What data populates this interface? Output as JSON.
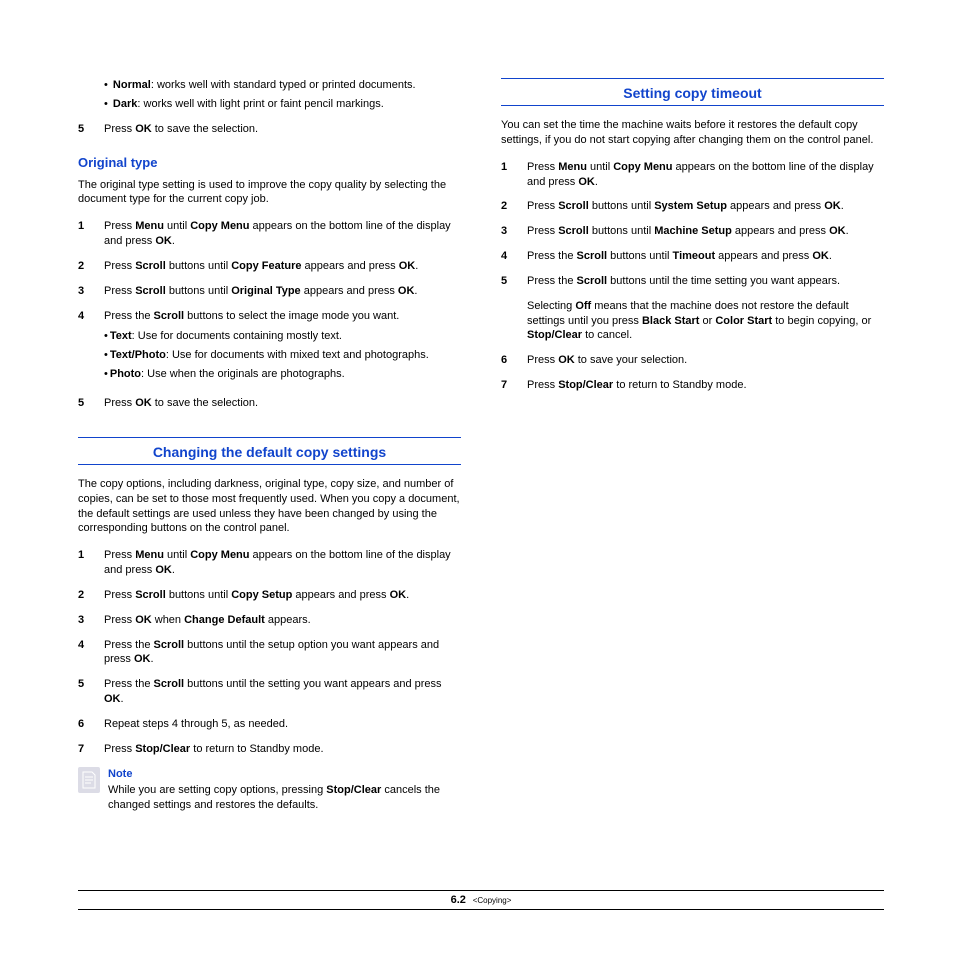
{
  "left": {
    "bullets": [
      {
        "term": "Normal",
        "desc": ": works well with standard typed or printed documents."
      },
      {
        "term": "Dark",
        "desc": ": works well with light print or faint pencil markings."
      }
    ],
    "step5_pre": "Press ",
    "step5_bold": "OK",
    "step5_post": " to save the selection.",
    "original_type_heading": "Original type",
    "original_type_intro": "The original type setting is used to improve the copy quality by selecting the document type for the current copy job.",
    "ot_steps": {
      "s1": {
        "t": "Press ",
        "b1": "Menu",
        "t2": " until ",
        "b2": "Copy Menu",
        "t3": " appears on the bottom line of the display and press ",
        "b3": "OK",
        "t4": "."
      },
      "s2": {
        "t": "Press ",
        "b1": "Scroll",
        "t2": " buttons until ",
        "b2": "Copy Feature",
        "t3": " appears and press ",
        "b3": "OK",
        "t4": "."
      },
      "s3": {
        "t": "Press ",
        "b1": "Scroll",
        "t2": " buttons until ",
        "b2": "Original Type",
        "t3": " appears and press ",
        "b3": "OK",
        "t4": "."
      },
      "s4": {
        "t": "Press the ",
        "b1": "Scroll",
        "t2": " buttons to select the image mode you want."
      },
      "s4_bullets": [
        {
          "term": "Text",
          "desc": ": Use for documents containing mostly text."
        },
        {
          "term": "Text/Photo",
          "desc": ": Use for documents with mixed text and photographs."
        },
        {
          "term": "Photo",
          "desc": ": Use when the originals are photographs."
        }
      ],
      "s5": {
        "t": "Press ",
        "b1": "OK",
        "t2": " to save the selection."
      }
    },
    "changing_heading": "Changing the default copy settings",
    "changing_intro": "The copy options, including darkness, original type, copy size, and number of copies, can be set to those most frequently used. When you copy a document, the default settings are used unless they have been changed by using the corresponding buttons on the control panel.",
    "ch_steps": {
      "s1": {
        "t": "Press ",
        "b1": "Menu",
        "t2": " until ",
        "b2": "Copy Menu",
        "t3": " appears on the bottom line of the display and press ",
        "b3": "OK",
        "t4": "."
      },
      "s2": {
        "t": "Press ",
        "b1": "Scroll",
        "t2": " buttons until ",
        "b2": "Copy Setup",
        "t3": " appears and press ",
        "b3": "OK",
        "t4": "."
      },
      "s3": {
        "t": "Press ",
        "b1": "OK",
        "t2": " when ",
        "b2": "Change Default",
        "t3": " appears."
      },
      "s4": {
        "t": "Press the ",
        "b1": "Scroll",
        "t2": " buttons until the setup option you want appears and press ",
        "b2": "OK",
        "t3": "."
      },
      "s5": {
        "t": "Press the ",
        "b1": "Scroll",
        "t2": " buttons until the setting you want appears and press ",
        "b2": "OK",
        "t3": "."
      },
      "s6": {
        "t": "Repeat steps 4 through 5, as needed."
      },
      "s7": {
        "t": "Press ",
        "b1": "Stop/Clear",
        "t2": " to return to Standby mode."
      }
    },
    "note_label": "Note",
    "note_pre": "While you are setting copy options, pressing ",
    "note_bold": "Stop/Clear",
    "note_post": " cancels the changed settings and restores the defaults."
  },
  "right": {
    "timeout_heading": "Setting copy timeout",
    "timeout_intro": "You can set the time the machine waits before it restores the default copy settings, if you do not start copying after changing them on the control panel.",
    "to_steps": {
      "s1": {
        "t": "Press ",
        "b1": "Menu",
        "t2": " until ",
        "b2": "Copy Menu",
        "t3": " appears on the bottom line of the display and press ",
        "b3": "OK",
        "t4": "."
      },
      "s2": {
        "t": "Press ",
        "b1": "Scroll",
        "t2": " buttons until ",
        "b2": "System Setup",
        "t3": " appears and press ",
        "b3": "OK",
        "t4": "."
      },
      "s3": {
        "t": "Press ",
        "b1": "Scroll",
        "t2": " buttons until ",
        "b2": "Machine Setup",
        "t3": " appears and press ",
        "b3": "OK",
        "t4": "."
      },
      "s4": {
        "t": "Press the ",
        "b1": "Scroll",
        "t2": " buttons until ",
        "b2": "Timeout",
        "t3": " appears and press ",
        "b3": "OK",
        "t4": "."
      },
      "s5": {
        "t": "Press the ",
        "b1": "Scroll",
        "t2": " buttons until the time setting you want appears."
      },
      "s5_extra": {
        "t": "Selecting ",
        "b1": "Off",
        "t2": " means that the machine does not restore the default settings until you press ",
        "b2": "Black Start",
        "t3": " or ",
        "b3": "Color Start",
        "t4": " to begin copying, or ",
        "b4": "Stop/Clear",
        "t5": " to cancel."
      },
      "s6": {
        "t": "Press ",
        "b1": "OK",
        "t2": " to save your selection."
      },
      "s7": {
        "t": "Press ",
        "b1": "Stop/Clear",
        "t2": " to return to Standby mode."
      }
    }
  },
  "footer": {
    "chapter": "6",
    "page": ".2",
    "section": "<Copying>"
  }
}
